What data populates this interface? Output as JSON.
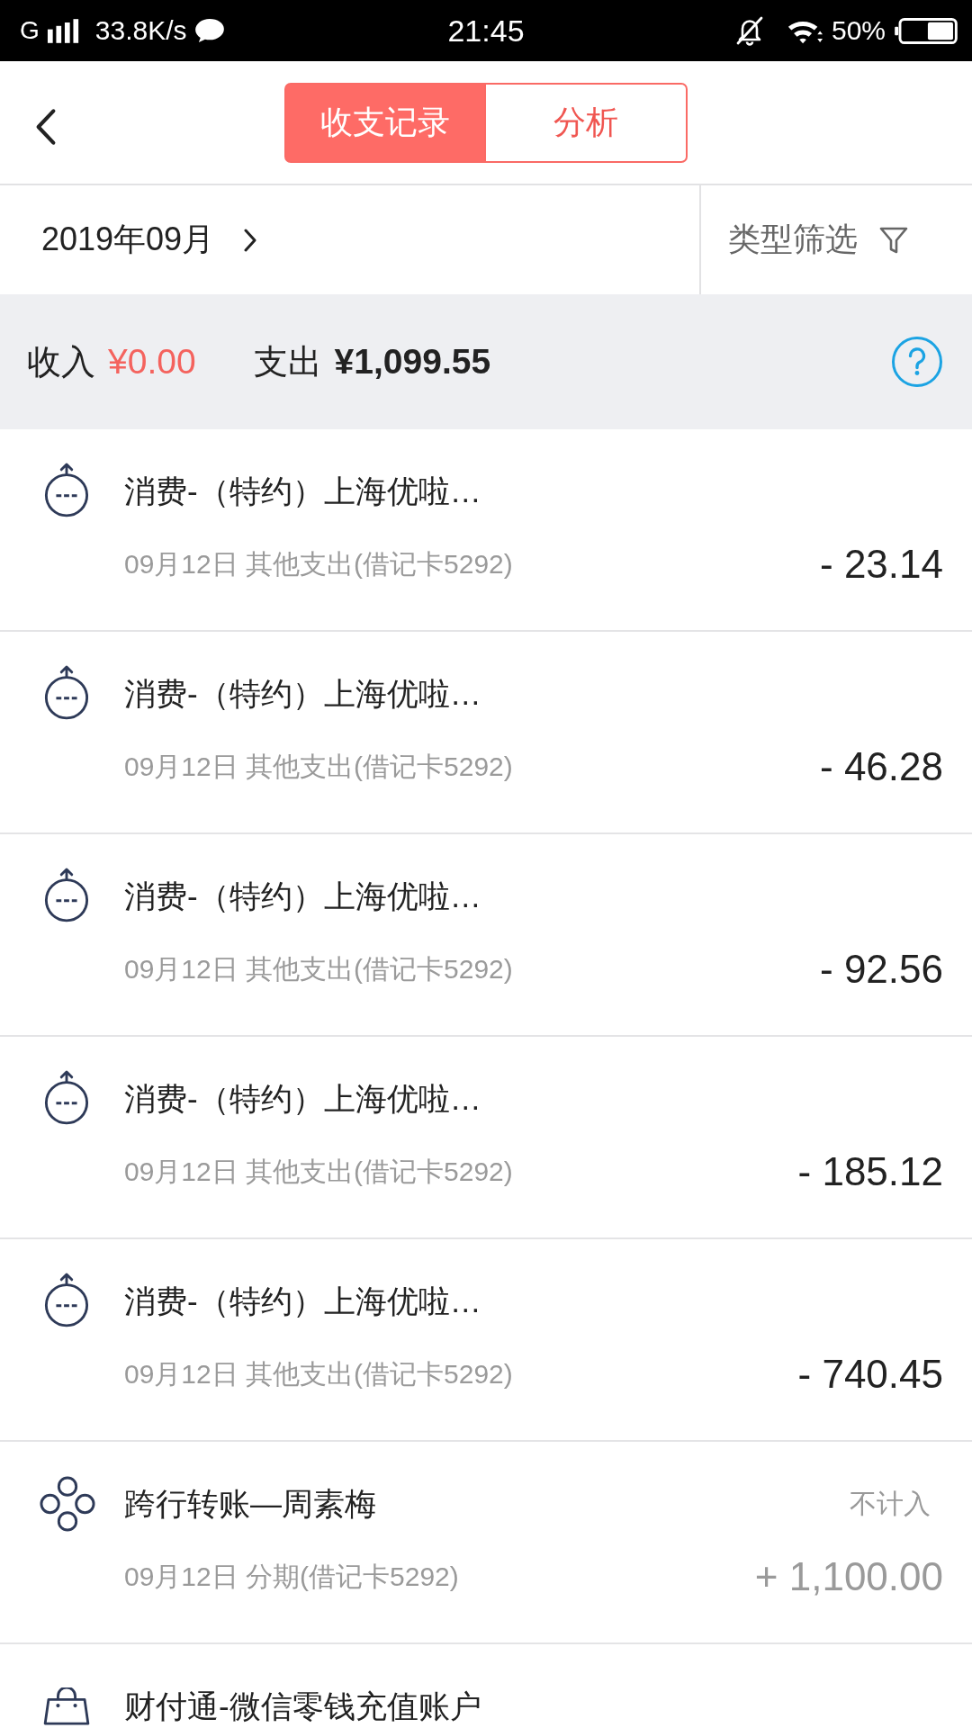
{
  "status_bar": {
    "network": "G",
    "speed": "33.8K/s",
    "time": "21:45",
    "battery": "50%"
  },
  "header": {
    "tabs": [
      {
        "label": "收支记录",
        "selected": true
      },
      {
        "label": "分析",
        "selected": false
      }
    ]
  },
  "filter_bar": {
    "month": "2019年09月",
    "type_filter": "类型筛选"
  },
  "summary": {
    "income_label": "收入",
    "income": "¥0.00",
    "expense_label": "支出",
    "expense": "¥1,099.55"
  },
  "transactions": [
    {
      "kind": "consume",
      "title": "消费-（特约）上海优啦…",
      "detail": "09月12日 其他支出(借记卡5292)",
      "amount": "- 23.14",
      "excluded": false
    },
    {
      "kind": "consume",
      "title": "消费-（特约）上海优啦…",
      "detail": "09月12日 其他支出(借记卡5292)",
      "amount": "- 46.28",
      "excluded": false
    },
    {
      "kind": "consume",
      "title": "消费-（特约）上海优啦…",
      "detail": "09月12日 其他支出(借记卡5292)",
      "amount": "- 92.56",
      "excluded": false
    },
    {
      "kind": "consume",
      "title": "消费-（特约）上海优啦…",
      "detail": "09月12日 其他支出(借记卡5292)",
      "amount": "- 185.12",
      "excluded": false
    },
    {
      "kind": "consume",
      "title": "消费-（特约）上海优啦…",
      "detail": "09月12日 其他支出(借记卡5292)",
      "amount": "- 740.45",
      "excluded": false
    },
    {
      "kind": "transfer",
      "title": "跨行转账—周素梅",
      "note": "不计入",
      "detail": "09月12日 分期(借记卡5292)",
      "amount": "+ 1,100.00",
      "excluded": true
    },
    {
      "kind": "shopping",
      "title": "财付通-微信零钱充值账户"
    }
  ]
}
